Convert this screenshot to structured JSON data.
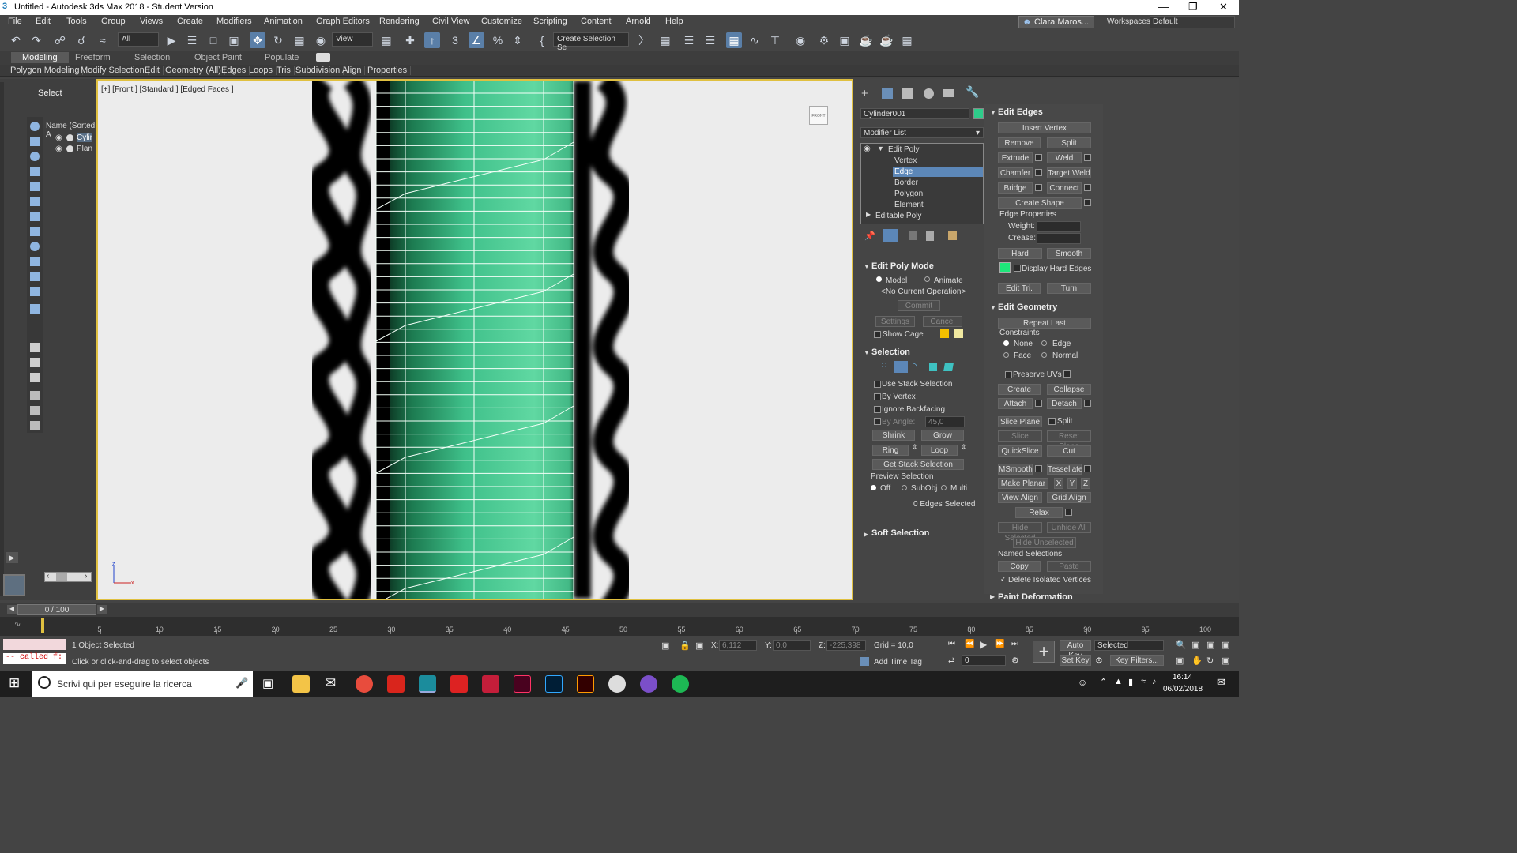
{
  "app": {
    "title": "Untitled - Autodesk 3ds Max 2018 - Student Version"
  },
  "menu": [
    "File",
    "Edit",
    "Tools",
    "Group",
    "Views",
    "Create",
    "Modifiers",
    "Animation",
    "Graph Editors",
    "Rendering",
    "Civil View",
    "Customize",
    "Scripting",
    "Content",
    "Arnold",
    "Help"
  ],
  "user": {
    "name": "Clara Maros...",
    "workspaces_label": "Workspaces:",
    "workspace": "Default"
  },
  "toolbar": {
    "filter": "All",
    "view": "View",
    "selection_set": "Create Selection Se"
  },
  "ribbon": {
    "tabs": [
      "Modeling",
      "Freeform",
      "Selection",
      "Object Paint",
      "Populate"
    ],
    "sub": [
      "Polygon Modeling",
      "Modify Selection",
      "Edit",
      "Geometry (All)",
      "Edges",
      "Loops",
      "Tris",
      "Subdivision",
      "Align",
      "Properties"
    ]
  },
  "scene": {
    "select_label": "Select",
    "column": "Name (Sorted A",
    "items": [
      "Cylin",
      "Plan"
    ]
  },
  "viewport": {
    "label": "[+] [Front ] [Standard ] [Edged Faces ]",
    "viewcube": "FRONT"
  },
  "cmd": {
    "object_name": "Cylinder001",
    "color": "#2ecc8a",
    "modifier_list": "Modifier List",
    "stack": [
      "Edit Poly",
      "Vertex",
      "Edge",
      "Border",
      "Polygon",
      "Element",
      "Editable Poly"
    ],
    "edit_poly_mode": {
      "title": "Edit Poly Mode",
      "model": "Model",
      "animate": "Animate",
      "op": "<No Current Operation>",
      "commit": "Commit",
      "settings": "Settings",
      "cancel": "Cancel",
      "show_cage": "Show Cage"
    },
    "selection": {
      "title": "Selection",
      "use_stack": "Use Stack Selection",
      "by_vertex": "By Vertex",
      "ignore_backfacing": "Ignore Backfacing",
      "by_angle": "By Angle:",
      "angle": "45,0",
      "shrink": "Shrink",
      "grow": "Grow",
      "ring": "Ring",
      "loop": "Loop",
      "get_stack": "Get Stack Selection",
      "preview": "Preview Selection",
      "off": "Off",
      "subobj": "SubObj",
      "multi": "Multi",
      "count": "0 Edges Selected"
    },
    "soft_selection": "Soft Selection",
    "edit_edges": {
      "title": "Edit Edges",
      "insert_vertex": "Insert Vertex",
      "remove": "Remove",
      "split": "Split",
      "extrude": "Extrude",
      "weld": "Weld",
      "chamfer": "Chamfer",
      "target_weld": "Target Weld",
      "bridge": "Bridge",
      "connect": "Connect",
      "create_shape": "Create Shape",
      "edge_props": "Edge Properties",
      "weight": "Weight:",
      "crease": "Crease:",
      "hard": "Hard",
      "smooth": "Smooth",
      "display_hard": "Display Hard Edges",
      "edit_tri": "Edit Tri.",
      "turn": "Turn"
    },
    "edit_geometry": {
      "title": "Edit Geometry",
      "repeat_last": "Repeat Last",
      "constraints": "Constraints",
      "none": "None",
      "edge": "Edge",
      "face": "Face",
      "normal": "Normal",
      "preserve_uvs": "Preserve UVs",
      "create": "Create",
      "collapse": "Collapse",
      "attach": "Attach",
      "detach": "Detach",
      "slice_plane": "Slice Plane",
      "split": "Split",
      "slice": "Slice",
      "reset_plane": "Reset Plane",
      "quickslice": "QuickSlice",
      "cut": "Cut",
      "msmooth": "MSmooth",
      "tessellate": "Tessellate",
      "make_planar": "Make Planar",
      "x": "X",
      "y": "Y",
      "z": "Z",
      "view_align": "View Align",
      "grid_align": "Grid Align",
      "relax": "Relax",
      "hide_selected": "Hide Selected",
      "unhide_all": "Unhide All",
      "hide_unselected": "Hide Unselected",
      "named_selections": "Named Selections:",
      "copy": "Copy",
      "paste": "Paste",
      "delete_isolated": "Delete Isolated Vertices"
    },
    "paint_deformation": "Paint Deformation"
  },
  "timeline": {
    "frame": "0 / 100",
    "ticks": [
      "5",
      "10",
      "15",
      "20",
      "25",
      "30",
      "35",
      "40",
      "45",
      "50",
      "55",
      "60",
      "65",
      "70",
      "75",
      "80",
      "85",
      "90",
      "95",
      "100"
    ]
  },
  "status": {
    "maxscript": "-- called f:",
    "selected": "1 Object Selected",
    "hint": "Click or click-and-drag to select objects",
    "x_label": "X:",
    "x": "6,112",
    "y_label": "Y:",
    "y": "0,0",
    "z_label": "Z:",
    "z": "-225,398",
    "grid": "Grid = 10,0",
    "add_time_tag": "Add Time Tag",
    "auto_key": "Auto Key",
    "set_key": "Set Key",
    "key_mode": "Selected",
    "key_filters": "Key Filters...",
    "frame_field": "0"
  },
  "taskbar": {
    "search": "Scrivi qui per eseguire la ricerca",
    "time": "16:14",
    "date": "06/02/2018"
  }
}
